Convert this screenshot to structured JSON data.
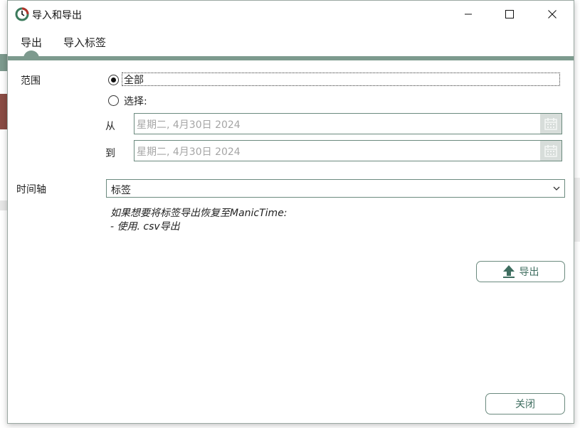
{
  "window": {
    "title": "导入和导出",
    "minimize_icon": "minimize-icon",
    "maximize_icon": "maximize-icon",
    "close_icon": "close-icon"
  },
  "tabs": [
    {
      "label": "导出",
      "active": true
    },
    {
      "label": "导入标签",
      "active": false
    }
  ],
  "range": {
    "label": "范围",
    "options": [
      {
        "label": "全部",
        "checked": true
      },
      {
        "label": "选择:",
        "checked": false
      }
    ],
    "from_label": "从",
    "to_label": "到",
    "from_date": "星期二, 4月30日 2024",
    "to_date": "星期二, 4月30日 2024"
  },
  "timeline": {
    "label": "时间轴",
    "selected": "标签"
  },
  "hint": {
    "line1": "如果想要将标签导出恢复至ManicTime:",
    "line2": "- 使用. csv导出"
  },
  "buttons": {
    "export_label": "导出",
    "close_label": "关闭"
  },
  "colors": {
    "accent": "#7d9a8e",
    "border": "#6b8a7e",
    "button_text": "#3f6e60"
  }
}
